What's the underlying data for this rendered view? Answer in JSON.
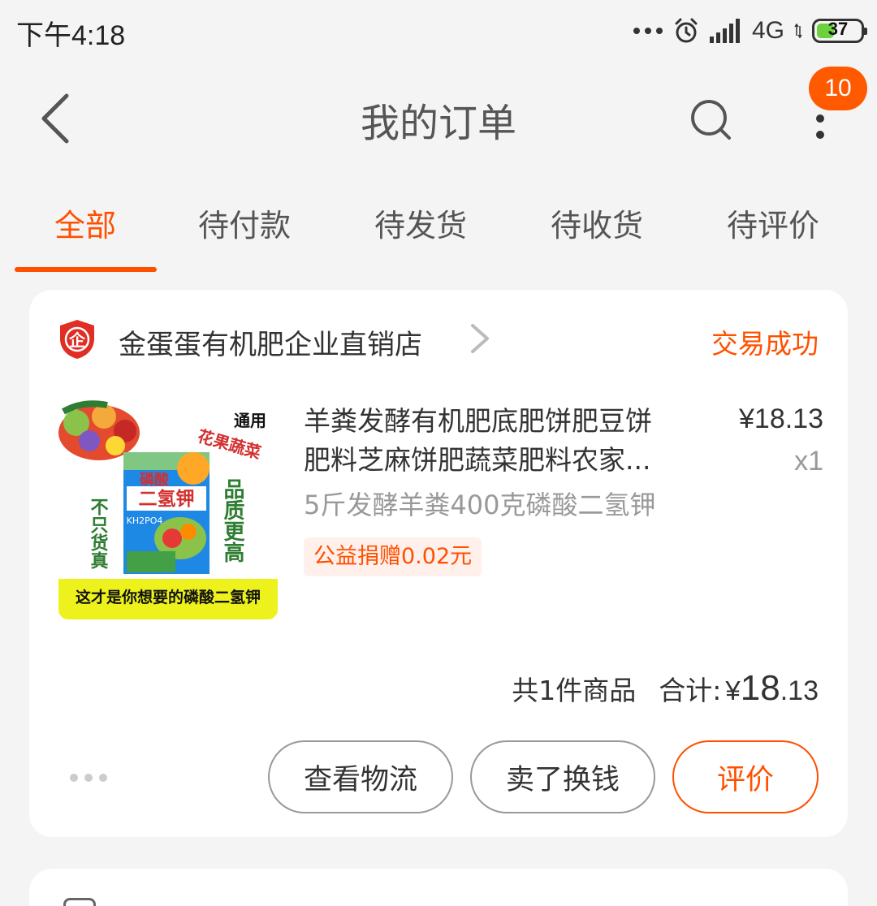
{
  "status_bar": {
    "time": "下午4:18",
    "network": "4G",
    "battery": "37"
  },
  "nav": {
    "title": "我的订单",
    "badge_count": "10"
  },
  "tabs": [
    {
      "label": "全部",
      "active": true
    },
    {
      "label": "待付款",
      "active": false
    },
    {
      "label": "待发货",
      "active": false
    },
    {
      "label": "待收货",
      "active": false
    },
    {
      "label": "待评价",
      "active": false
    }
  ],
  "order": {
    "shop_name": "金蛋蛋有机肥企业直销店",
    "shop_icon_text": "企",
    "status": "交易成功",
    "product": {
      "title_line1": "羊粪发酵有机肥底肥饼肥豆饼",
      "title_line2": "肥料芝麻饼肥蔬菜肥料农家...",
      "sku": "5斤发酵羊粪400克磷酸二氢钾",
      "donation": "公益捐赠0.02元",
      "price": "¥18.13",
      "qty": "x1",
      "image_texts": {
        "tag1": "通用",
        "tag2": "花果蔬菜",
        "left_text": "不只货真",
        "right_text": "品质更高",
        "pkg_top": "磷酸",
        "pkg_main": "二氢钾",
        "pkg_formula": "KH2PO4",
        "banner": "这才是你想要的磷酸二氢钾"
      }
    },
    "summary": {
      "count": "共1件商品",
      "total_label": "合计:",
      "currency": "¥",
      "total_yuan": "18",
      "total_fen": ".13"
    },
    "actions": {
      "logistics": "查看物流",
      "resell": "卖了换钱",
      "review": "评价"
    }
  },
  "colors": {
    "accent": "#ff5000",
    "badge": "#ff5a00",
    "background": "#f4f4f4"
  }
}
